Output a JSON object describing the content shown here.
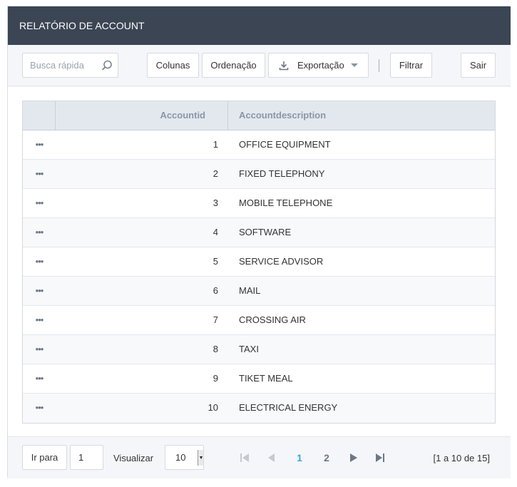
{
  "title": "RELATÓRIO DE ACCOUNT",
  "toolbar": {
    "search_placeholder": "Busca rápida",
    "columns": "Colunas",
    "order": "Ordenação",
    "export": "Exportação",
    "filter": "Filtrar",
    "exit": "Sair"
  },
  "grid": {
    "headers": [
      "Accountid",
      "Accountdescription"
    ],
    "row_menu": "•••",
    "rows": [
      {
        "id": "1",
        "desc": "OFFICE EQUIPMENT"
      },
      {
        "id": "2",
        "desc": "FIXED TELEPHONY"
      },
      {
        "id": "3",
        "desc": "MOBILE TELEPHONE"
      },
      {
        "id": "4",
        "desc": "SOFTWARE"
      },
      {
        "id": "5",
        "desc": "SERVICE ADVISOR"
      },
      {
        "id": "6",
        "desc": "MAIL"
      },
      {
        "id": "7",
        "desc": "CROSSING AIR"
      },
      {
        "id": "8",
        "desc": "TAXI"
      },
      {
        "id": "9",
        "desc": "TIKET MEAL"
      },
      {
        "id": "10",
        "desc": "ELECTRICAL ENERGY"
      }
    ]
  },
  "footer": {
    "goto_label": "Ir para",
    "goto_value": "1",
    "view_label": "Visualizar",
    "page_size": "10",
    "pages": [
      "1",
      "2"
    ],
    "current_page": "1",
    "range_text": "[1 a 10 de 15]"
  },
  "icons": {
    "search": "search-icon",
    "export": "download-icon",
    "dropdown": "caret-down-icon",
    "first": "first-page-icon",
    "prev": "prev-page-icon",
    "next": "next-page-icon",
    "last": "last-page-icon"
  },
  "colors": {
    "header_bg": "#3b4554",
    "accent_page": "#3aa7e0",
    "grid_header_bg": "#e3e8ef"
  }
}
